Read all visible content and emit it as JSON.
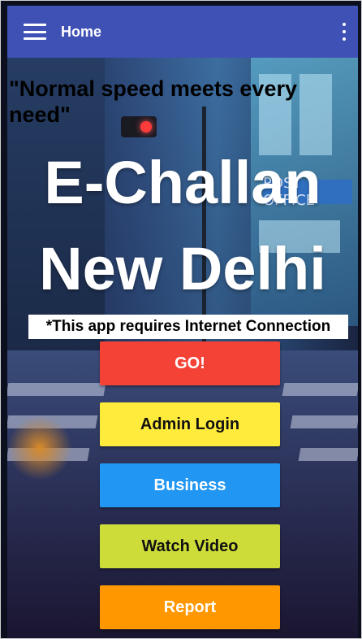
{
  "appbar": {
    "title": "Home",
    "menu_icon": "hamburger-menu-icon",
    "overflow_icon": "more-vert-icon",
    "color": "#3f51b5"
  },
  "hero": {
    "quote": "\"Normal speed meets every need\"",
    "title_line1": "E-Challan",
    "title_line2": "New Delhi",
    "notice": "*This app requires Internet Connection",
    "background_sign": "POST OFFICE"
  },
  "buttons": {
    "go": {
      "label": "GO!",
      "color": "#f44336"
    },
    "admin_login": {
      "label": "Admin Login",
      "color": "#ffeb3b"
    },
    "business": {
      "label": "Business",
      "color": "#2196f3"
    },
    "watch_video": {
      "label": "Watch Video",
      "color": "#cddc39"
    },
    "report": {
      "label": "Report",
      "color": "#ff9800"
    }
  }
}
